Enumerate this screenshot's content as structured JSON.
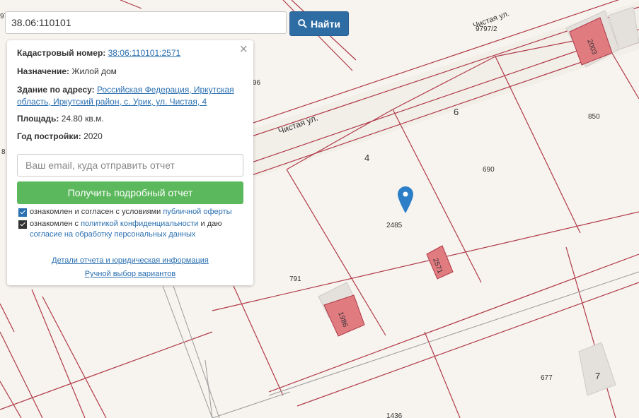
{
  "search": {
    "value": "38.06:110101",
    "button_label": "Найти"
  },
  "info": {
    "cadastral_label": "Кадастровый номер:",
    "cadastral_value": "38:06:110101:2571",
    "purpose_label": "Назначение:",
    "purpose_value": "Жилой дом",
    "address_label": "Здание по адресу:",
    "address_value": "Российская Федерация, Иркутская область, Иркутский район, с. Урик, ул. Чистая, 4",
    "area_label": "Площадь:",
    "area_value": "24.80 кв.м.",
    "year_label": "Год постройки:",
    "year_value": "2020"
  },
  "report": {
    "email_placeholder": "Ваш email, куда отправить отчет",
    "button_label": "Получить подробный отчет",
    "consent1_text": "ознакомлен и согласен с условиями ",
    "consent1_link": "публичной оферты",
    "consent2_text": "ознакомлен с ",
    "consent2_link1": "политикой конфиденциальности",
    "consent2_mid": " и даю ",
    "consent2_link2": "согласие на обработку персональных данных",
    "details_link": "Детали отчета и юридическая информация",
    "manual_link": "Ручной выбор вариантов",
    "close_symbol": "×"
  },
  "map": {
    "street_label_1": "Чистая ул.",
    "street_label_2": "Чистая ул.",
    "street_number": "9797/2",
    "parcel_labels": [
      "4",
      "6",
      "7",
      "2485",
      "690",
      "850",
      "791",
      "677",
      "1436",
      "96",
      "38:06:110101:2571"
    ],
    "building_labels": [
      "2003",
      "1986",
      "2571"
    ],
    "edge_labels": [
      "97",
      "8"
    ],
    "colors": {
      "parcel_line": "#b03a48",
      "building": "#e07b80",
      "marker": "#2c7fc6"
    }
  }
}
